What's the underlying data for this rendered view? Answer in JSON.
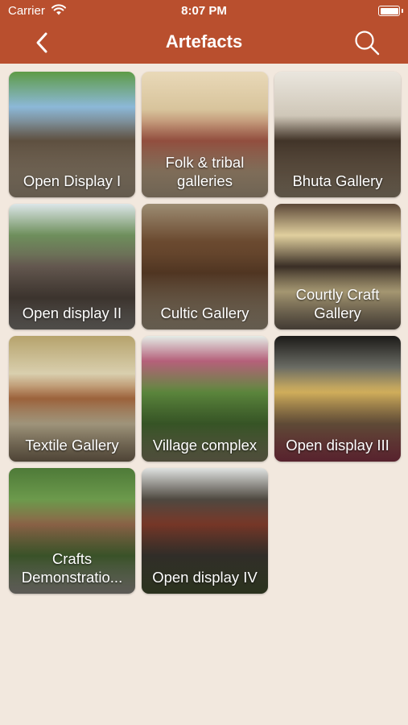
{
  "status_bar": {
    "carrier": "Carrier",
    "time": "8:07 PM"
  },
  "nav": {
    "title": "Artefacts",
    "back_icon": "chevron-left-icon",
    "search_icon": "search-icon"
  },
  "colors": {
    "header": "#b94f2e",
    "background": "#f2e8de"
  },
  "galleries": [
    {
      "label": "Open Display I"
    },
    {
      "label": "Folk & tribal galleries"
    },
    {
      "label": "Bhuta Gallery"
    },
    {
      "label": "Open display II"
    },
    {
      "label": "Cultic Gallery"
    },
    {
      "label": "Courtly Craft Gallery"
    },
    {
      "label": "Textile Gallery"
    },
    {
      "label": "Village complex"
    },
    {
      "label": "Open display III"
    },
    {
      "label": "Crafts Demonstratio..."
    },
    {
      "label": "Open display IV"
    }
  ]
}
